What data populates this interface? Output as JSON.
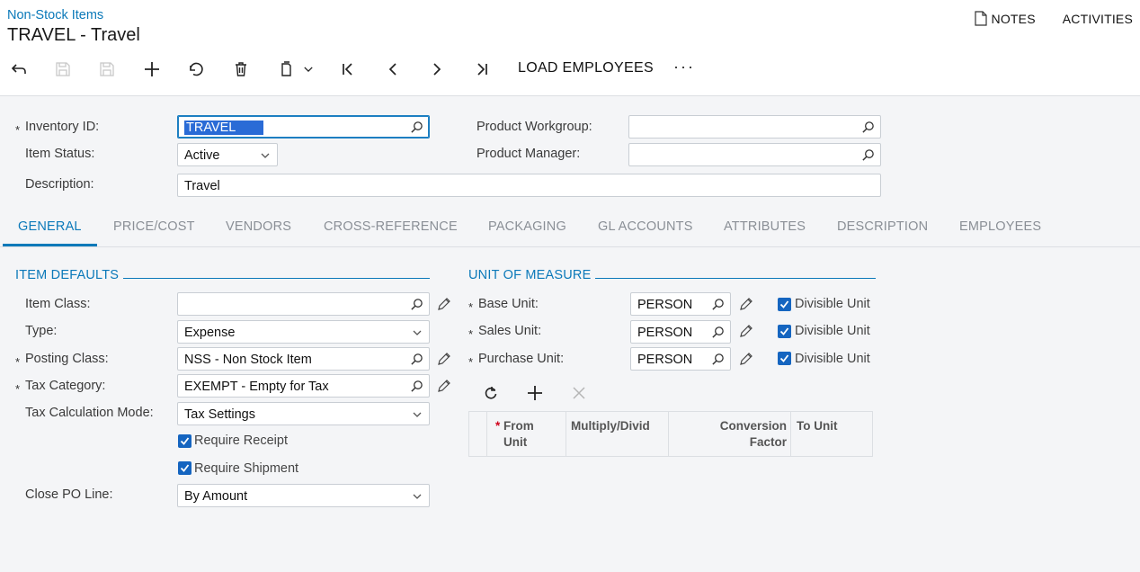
{
  "breadcrumb": "Non-Stock Items",
  "title": "TRAVEL - Travel",
  "top_links": {
    "notes": "NOTES",
    "activities": "ACTIVITIES"
  },
  "toolbar": {
    "icons": [
      "back-icon",
      "save-close-icon",
      "save-icon",
      "add-icon",
      "undo-icon",
      "delete-icon",
      "copy-paste-icon",
      "first-record-icon",
      "previous-record-icon",
      "next-record-icon",
      "last-record-icon"
    ],
    "load_employees": "LOAD EMPLOYEES",
    "more": "···"
  },
  "form": {
    "inventory_id": {
      "label": "Inventory ID:",
      "value": "TRAVEL"
    },
    "item_status": {
      "label": "Item Status:",
      "value": "Active"
    },
    "description": {
      "label": "Description:",
      "value": "Travel"
    },
    "product_workgroup": {
      "label": "Product Workgroup:",
      "value": ""
    },
    "product_manager": {
      "label": "Product Manager:",
      "value": ""
    }
  },
  "tabs": [
    "GENERAL",
    "PRICE/COST",
    "VENDORS",
    "CROSS-REFERENCE",
    "PACKAGING",
    "GL ACCOUNTS",
    "ATTRIBUTES",
    "DESCRIPTION",
    "EMPLOYEES"
  ],
  "active_tab": "GENERAL",
  "item_defaults": {
    "title": "ITEM DEFAULTS",
    "item_class": {
      "label": "Item Class:",
      "value": ""
    },
    "type": {
      "label": "Type:",
      "value": "Expense"
    },
    "posting_class": {
      "label": "Posting Class:",
      "value": "NSS - Non Stock Item"
    },
    "tax_category": {
      "label": "Tax Category:",
      "value": "EXEMPT - Empty for Tax"
    },
    "tax_calc_mode": {
      "label": "Tax Calculation Mode:",
      "value": "Tax Settings"
    },
    "require_receipt": {
      "label": "Require Receipt",
      "checked": true
    },
    "require_shipment": {
      "label": "Require Shipment",
      "checked": true
    },
    "close_po_line": {
      "label": "Close PO Line:",
      "value": "By Amount"
    }
  },
  "unit_of_measure": {
    "title": "UNIT OF MEASURE",
    "base_unit": {
      "label": "Base Unit:",
      "value": "PERSON",
      "divisible_label": "Divisible Unit",
      "divisible": true
    },
    "sales_unit": {
      "label": "Sales Unit:",
      "value": "PERSON",
      "divisible_label": "Divisible Unit",
      "divisible": true
    },
    "purchase_unit": {
      "label": "Purchase Unit:",
      "value": "PERSON",
      "divisible_label": "Divisible Unit",
      "divisible": true
    },
    "grid_columns": {
      "from_unit_1": "From",
      "from_unit_2": "Unit",
      "multiply_divide": "Multiply/Divid",
      "conversion_factor_1": "Conversion",
      "conversion_factor_2": "Factor",
      "to_unit": "To Unit"
    }
  },
  "colors": {
    "accent": "#0b79b9",
    "checkbox": "#1565c0",
    "selection": "#2a6bd6",
    "background": "#f4f5f7"
  }
}
